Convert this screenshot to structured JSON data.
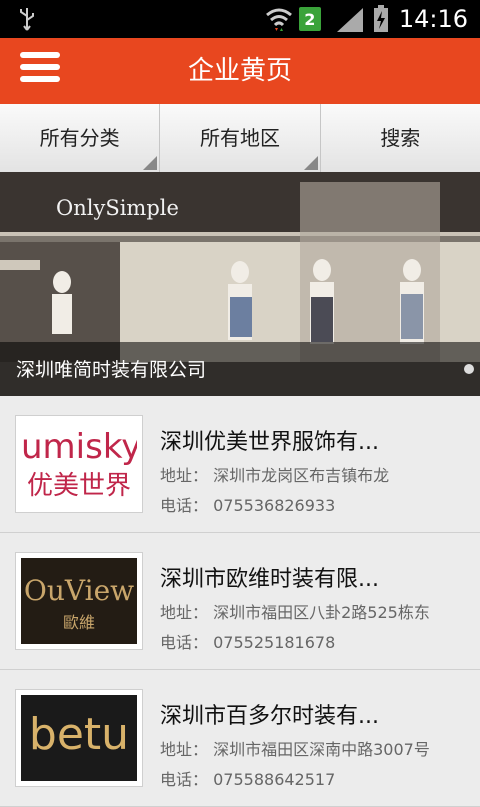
{
  "status": {
    "time": "14:16",
    "sim_slot": "2"
  },
  "header": {
    "title": "企业黄页",
    "menu_icon": "hamburger-icon",
    "color": "#e8471f"
  },
  "tabs": [
    {
      "label": "所有分类"
    },
    {
      "label": "所有地区"
    },
    {
      "label": "搜索"
    }
  ],
  "banner": {
    "caption": "深圳唯简时装有限公司",
    "storefront_text": "OnlySimple"
  },
  "companies": [
    {
      "name": "深圳优美世界服饰有...",
      "address_label": "地址：",
      "address": "深圳市龙岗区布吉镇布龙",
      "phone_label": "电话：",
      "phone": "075536826933",
      "logo": {
        "latin": "umisky",
        "chinese": "优美世界"
      }
    },
    {
      "name": "深圳市欧维时装有限...",
      "address_label": "地址：",
      "address": "深圳市福田区八卦2路525栋东",
      "phone_label": "电话：",
      "phone": "075525181678",
      "logo": {
        "latin": "OuView",
        "chinese": "歐維"
      }
    },
    {
      "name": "深圳市百多尔时装有...",
      "address_label": "地址：",
      "address": "深圳市福田区深南中路3007号",
      "phone_label": "电话：",
      "phone": "075588642517",
      "logo": {
        "latin": "betu"
      }
    }
  ]
}
